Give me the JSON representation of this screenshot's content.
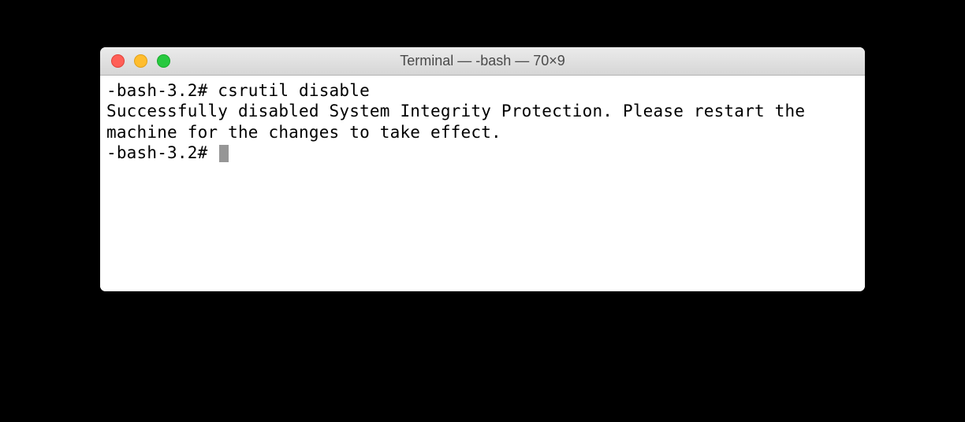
{
  "window": {
    "title": "Terminal — -bash — 70×9"
  },
  "terminal": {
    "line1_prompt": "-bash-3.2# ",
    "line1_command": "csrutil disable",
    "line2": "Successfully disabled System Integrity Protection. Please restart the machine for the changes to take effect.",
    "line3_prompt": "-bash-3.2# "
  }
}
